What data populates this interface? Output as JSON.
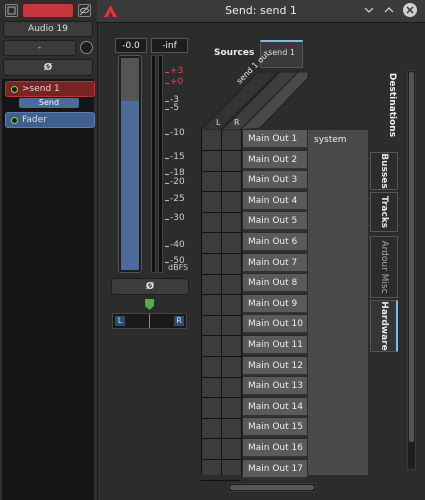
{
  "strip": {
    "name": "Audio 19",
    "input_button": "-",
    "phase_button": "Ø",
    "plugins": [
      {
        "label": ">send 1",
        "sublabel": "Send"
      },
      {
        "label": "Fader"
      }
    ]
  },
  "window": {
    "title": "Send: send 1"
  },
  "meter": {
    "peak_left": "-0.0",
    "peak_right": "-inf",
    "fader_level": 0.79,
    "ticks": [
      "+3",
      "+0",
      "-3",
      "-5",
      "-10",
      "-15",
      "-18",
      "-20",
      "-25",
      "-30",
      "-40",
      "-50"
    ],
    "unit": "dBFS",
    "phase_button": "Ø",
    "pan_left": "L",
    "pan_right": "R",
    "pan_position": 0.5
  },
  "matrix": {
    "sources_label": "Sources",
    "source_tab": "send 1",
    "source_group": "send 1 out",
    "source_ports": [
      "L",
      "R"
    ],
    "destinations_label": "Destinations",
    "destination_group": "system",
    "destination_ports": [
      "Main Out 1",
      "Main Out 2",
      "Main Out 3",
      "Main Out 4",
      "Main Out 5",
      "Main Out 6",
      "Main Out 7",
      "Main Out 8",
      "Main Out 9",
      "Main Out 10",
      "Main Out 11",
      "Main Out 12",
      "Main Out 13",
      "Main Out 14",
      "Main Out 15",
      "Main Out 16",
      "Main Out 17"
    ],
    "tabs": [
      "Busses",
      "Tracks",
      "Ardour Misc",
      "Hardware"
    ],
    "active_tab": "Hardware"
  },
  "colors": {
    "record_red": "#c8363f",
    "send_plugin": "#7a2323",
    "fader_plugin": "#3f5f8c",
    "meter_fill": "#4d6a9b",
    "accent": "#71c2e6",
    "led_green": "#8ed46a"
  }
}
